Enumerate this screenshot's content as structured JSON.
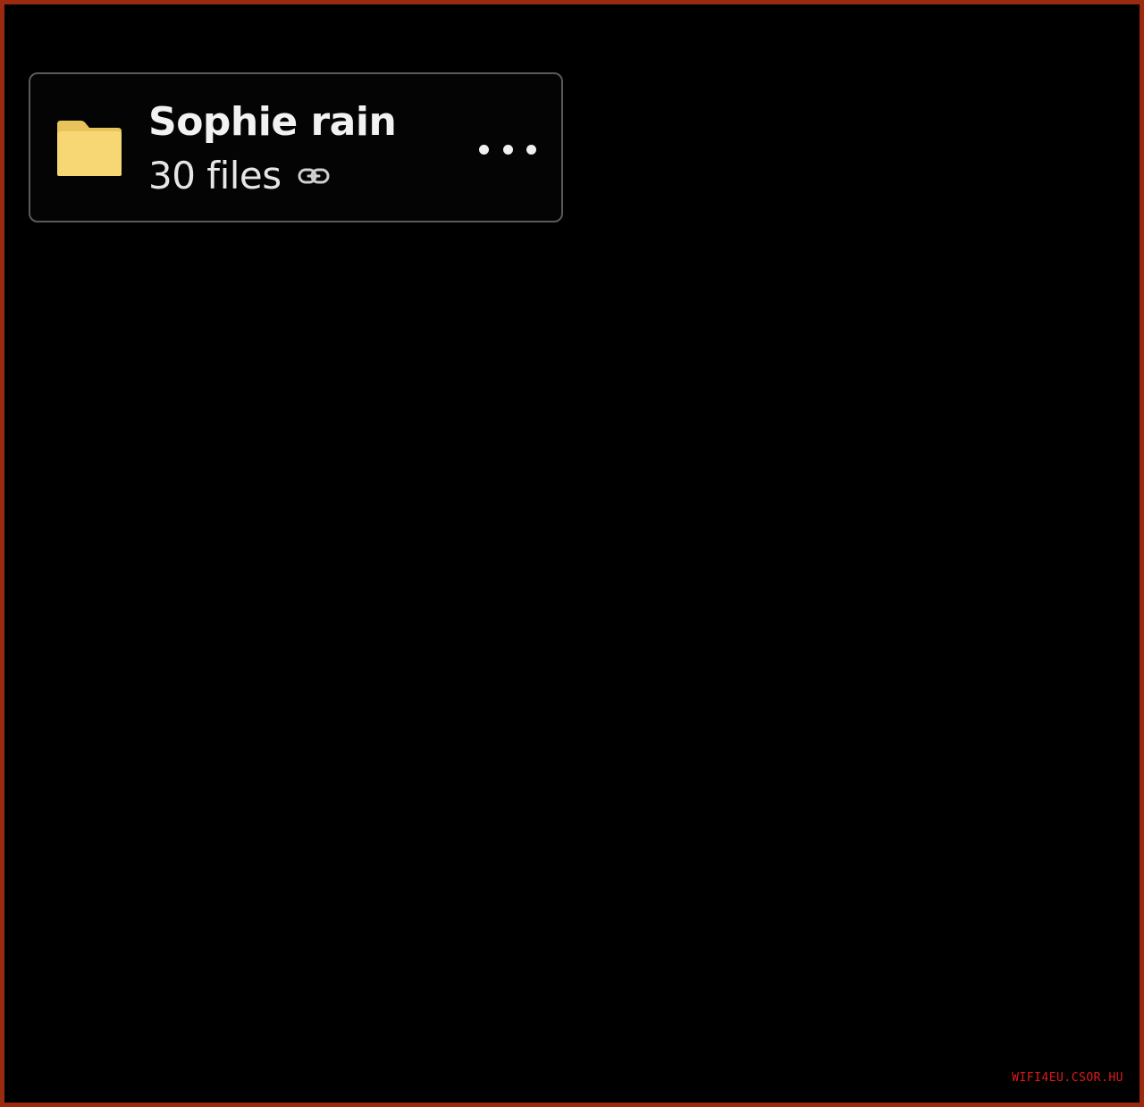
{
  "folder": {
    "name": "Sophie rain",
    "file_count": "30 files",
    "icon": "folder-icon",
    "link_icon": "link-icon",
    "menu_icon": "more-horizontal-icon",
    "icon_color": "#f7d774"
  },
  "watermark": {
    "text": "WIFI4EU.CSOR.HU"
  },
  "colors": {
    "background": "#000000",
    "frame_border": "#9b2a10",
    "card_border": "#5a5a5a",
    "text": "#f2f2f2",
    "watermark": "#e01a1a"
  }
}
